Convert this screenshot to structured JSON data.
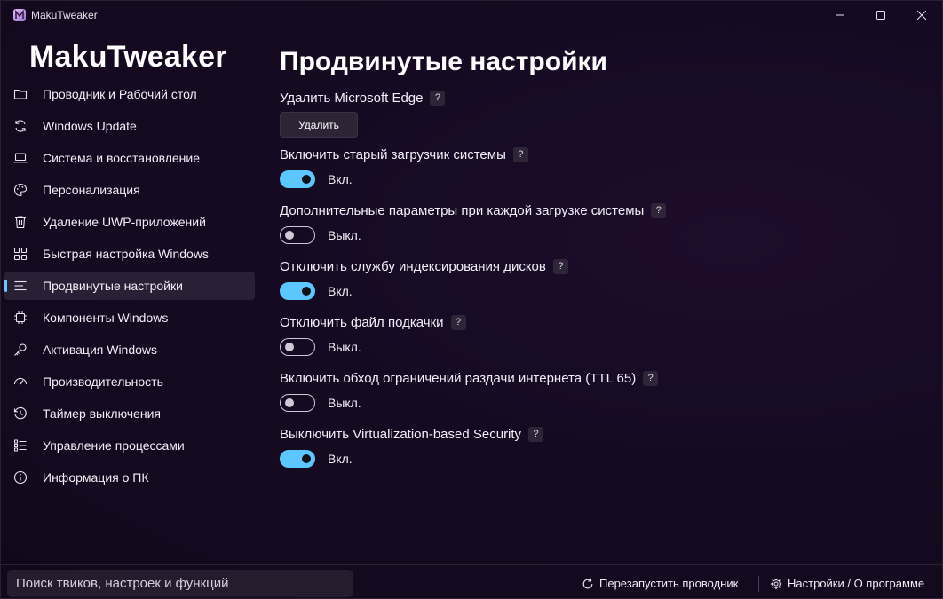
{
  "window": {
    "title": "MakuTweaker"
  },
  "sidebar": {
    "brand": "MakuTweaker",
    "items": [
      {
        "label": "Проводник и Рабочий стол",
        "icon": "folder-icon"
      },
      {
        "label": "Windows Update",
        "icon": "sync-icon"
      },
      {
        "label": "Система и восстановление",
        "icon": "laptop-icon"
      },
      {
        "label": "Персонализация",
        "icon": "palette-icon"
      },
      {
        "label": "Удаление UWP-приложений",
        "icon": "trash-icon"
      },
      {
        "label": "Быстрая настройка Windows",
        "icon": "grid-icon"
      },
      {
        "label": "Продвинутые настройки",
        "icon": "menu-lines-icon",
        "active": true
      },
      {
        "label": "Компоненты Windows",
        "icon": "chip-icon"
      },
      {
        "label": "Активация Windows",
        "icon": "key-icon"
      },
      {
        "label": "Производительность",
        "icon": "gauge-icon"
      },
      {
        "label": "Таймер выключения",
        "icon": "history-icon"
      },
      {
        "label": "Управление процессами",
        "icon": "checklist-icon"
      },
      {
        "label": "Информация о ПК",
        "icon": "info-icon"
      }
    ]
  },
  "main": {
    "title": "Продвинутые настройки",
    "settings": [
      {
        "label": "Удалить Microsoft Edge",
        "help": "?",
        "type": "button",
        "button_label": "Удалить"
      },
      {
        "label": "Включить старый загрузчик системы",
        "help": "?",
        "type": "toggle",
        "on": true,
        "state_text": "Вкл."
      },
      {
        "label": "Дополнительные параметры при каждой загрузке системы",
        "help": "?",
        "type": "toggle",
        "on": false,
        "state_text": "Выкл."
      },
      {
        "label": "Отключить службу индексирования дисков",
        "help": "?",
        "type": "toggle",
        "on": true,
        "state_text": "Вкл."
      },
      {
        "label": "Отключить файл подкачки",
        "help": "?",
        "type": "toggle",
        "on": false,
        "state_text": "Выкл."
      },
      {
        "label": "Включить обход ограничений раздачи интернета (TTL 65)",
        "help": "?",
        "type": "toggle",
        "on": false,
        "state_text": "Выкл."
      },
      {
        "label": "Выключить Virtualization-based Security",
        "help": "?",
        "type": "toggle",
        "on": true,
        "state_text": "Вкл."
      }
    ]
  },
  "bottombar": {
    "search_placeholder": "Поиск твиков, настроек и функций",
    "restart_label": "Перезапустить проводник",
    "settings_label": "Настройки / О программе"
  },
  "colors": {
    "accent": "#5cc6ff",
    "background": "#14091e",
    "sidebar_active": "#2a2036"
  }
}
